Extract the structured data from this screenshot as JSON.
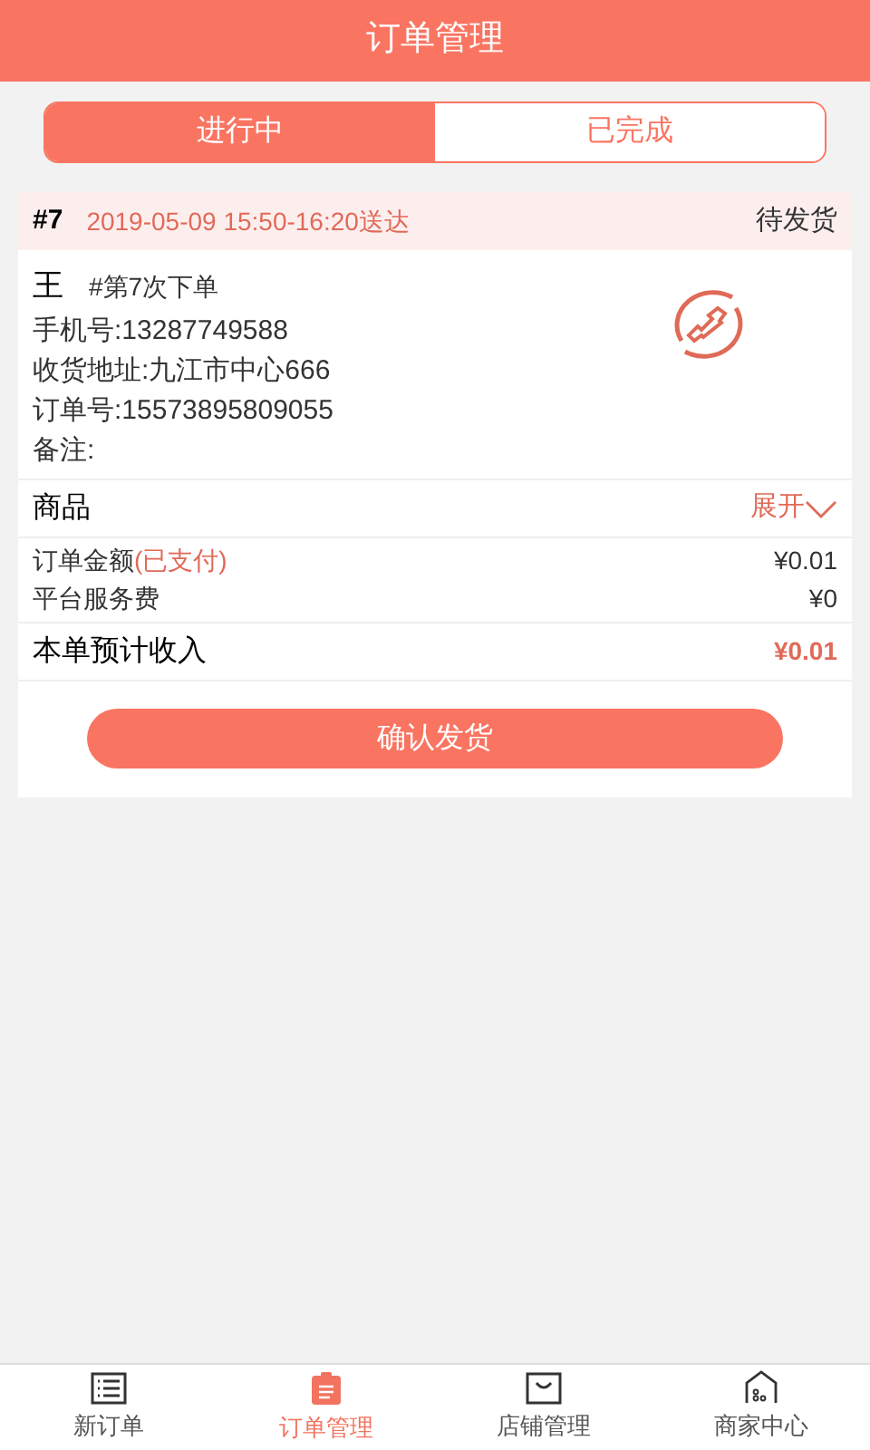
{
  "header": {
    "title": "订单管理"
  },
  "tabs": [
    {
      "label": "进行中",
      "selected": true
    },
    {
      "label": "已完成",
      "selected": false
    }
  ],
  "order": {
    "number": "#7",
    "delivery_time": "2019-05-09 15:50-16:20送达",
    "status": "待发货",
    "customer": "王",
    "order_count": "#第7次下单",
    "details": [
      "手机号:13287749588",
      "收货地址:九江市中心666",
      "订单号:15573895809055",
      "备注:"
    ],
    "goods": {
      "label": "商品",
      "toggle": "展开",
      "expanded": false
    },
    "fees": [
      {
        "label": "订单金额",
        "note": "(已支付)",
        "value": "¥0.01"
      },
      {
        "label": "平台服务费",
        "value": "¥0"
      }
    ],
    "income": {
      "label": "本单预计收入",
      "value": "¥0.01"
    },
    "button": "确认发货"
  },
  "bottom_nav": [
    {
      "label": "新订单",
      "kind": "list",
      "selected": false
    },
    {
      "label": "订单管理",
      "kind": "clipboard",
      "selected": true
    },
    {
      "label": "店铺管理",
      "kind": "bag",
      "selected": false
    },
    {
      "label": "商家中心",
      "kind": "home",
      "selected": false
    }
  ]
}
